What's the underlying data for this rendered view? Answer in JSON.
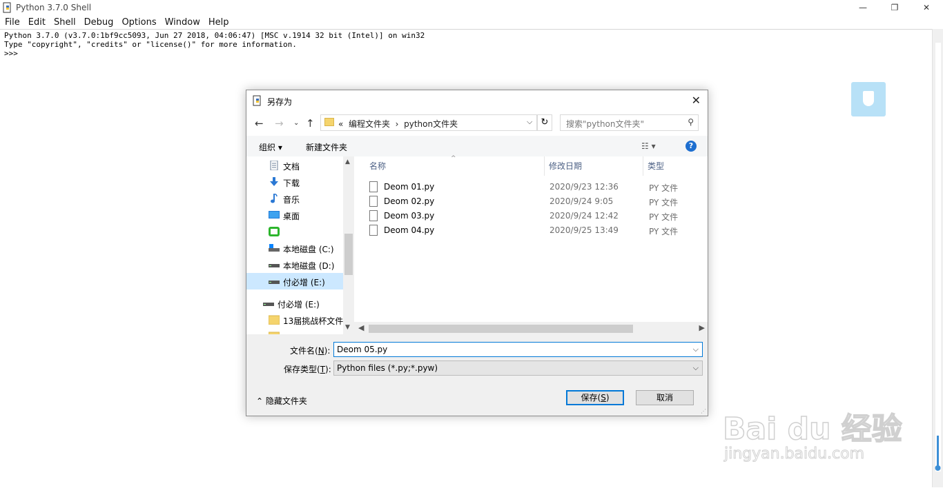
{
  "window": {
    "title": "Python 3.7.0 Shell",
    "controls": {
      "minimize": "—",
      "restore": "❐",
      "close": "✕"
    }
  },
  "menu": [
    "File",
    "Edit",
    "Shell",
    "Debug",
    "Options",
    "Window",
    "Help"
  ],
  "shell": {
    "lines": [
      "Python 3.7.0 (v3.7.0:1bf9cc5093, Jun 27 2018, 04:06:47) [MSC v.1914 32 bit (Intel)] on win32",
      "Type \"copyright\", \"credits\" or \"license()\" for more information.",
      ">>> "
    ]
  },
  "dialog": {
    "title": "另存为",
    "close": "✕",
    "address": {
      "prefix": "«",
      "crumbs": [
        "编程文件夹",
        "python文件夹"
      ],
      "separator": "›"
    },
    "search_placeholder": "搜索\"python文件夹\"",
    "toolbar": {
      "organize": "组织 ▾",
      "new_folder": "新建文件夹",
      "help": "?"
    },
    "nav_items": [
      {
        "label": "文档",
        "icon": "documents-icon"
      },
      {
        "label": "下载",
        "icon": "downloads-icon"
      },
      {
        "label": "音乐",
        "icon": "music-icon"
      },
      {
        "label": "桌面",
        "icon": "desktop-icon"
      },
      {
        "label": "",
        "icon": "green-app-icon"
      },
      {
        "label": "本地磁盘 (C:)",
        "icon": "drive-icon"
      },
      {
        "label": "本地磁盘 (D:)",
        "icon": "drive-icon"
      },
      {
        "label": "付必增 (E:)",
        "icon": "drive-icon",
        "selected": true
      },
      {
        "label": "付必增 (E:)",
        "icon": "drive-icon"
      },
      {
        "label": "13届挑战杯文件",
        "icon": "folder-icon"
      }
    ],
    "columns": {
      "name": "名称",
      "date": "修改日期",
      "type": "类型"
    },
    "files": [
      {
        "name": "Deom 01.py",
        "date": "2020/9/23 12:36",
        "type": "PY 文件"
      },
      {
        "name": "Deom 02.py",
        "date": "2020/9/24 9:05",
        "type": "PY 文件"
      },
      {
        "name": "Deom 03.py",
        "date": "2020/9/24 12:42",
        "type": "PY 文件"
      },
      {
        "name": "Deom 04.py",
        "date": "2020/9/25 13:49",
        "type": "PY 文件"
      }
    ],
    "filename_label": {
      "text": "文件名(",
      "key": "N",
      "end": "):"
    },
    "filename_value": "Deom 05.py",
    "filetype_label": {
      "text": "保存类型(",
      "key": "T",
      "end": "):"
    },
    "filetype_value": "Python files (*.py;*.pyw)",
    "hide_folders": "隐藏文件夹",
    "save_button": {
      "text": "保存(",
      "key": "S",
      "end": ")"
    },
    "cancel_button": "取消"
  },
  "watermark": {
    "brand": "Bai du 经验",
    "url": "jingyan.baidu.com"
  },
  "colors": {
    "accent": "#0078d7",
    "selection": "#cce8ff",
    "help": "#1e6fd0"
  }
}
